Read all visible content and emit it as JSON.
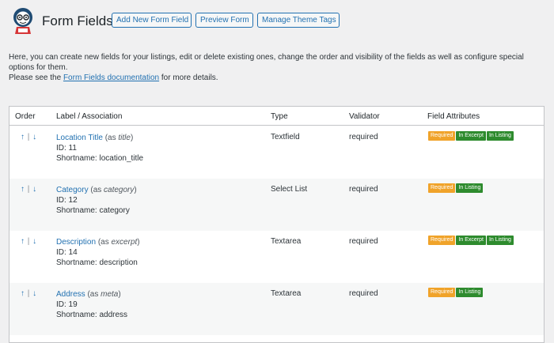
{
  "header": {
    "title": "Form Fields",
    "buttons": {
      "add": "Add New Form Field",
      "preview": "Preview Form",
      "tags": "Manage Theme Tags"
    }
  },
  "intro": {
    "line1": "Here, you can create new fields for your listings, edit or delete existing ones, change the order and visibility of the fields as well as configure special options for them.",
    "line2_prefix": "Please see the ",
    "link": "Form Fields documentation",
    "line2_suffix": " for more details."
  },
  "table": {
    "headers": {
      "order": "Order",
      "label": "Label / Association",
      "type": "Type",
      "validator": "Validator",
      "attributes": "Field Attributes"
    },
    "arrows": {
      "up": "↑",
      "sep": "|",
      "down": "↓"
    },
    "rows": [
      {
        "name": "Location Title",
        "assoc_pre": "(as ",
        "assoc": "title",
        "assoc_post": ")",
        "id": "ID: 11",
        "shortname": "Shortname: location_title",
        "type": "Textfield",
        "validator": "required",
        "badges": [
          "Required",
          "In Excerpt",
          "In Listing"
        ]
      },
      {
        "name": "Category",
        "assoc_pre": "(as ",
        "assoc": "category",
        "assoc_post": ")",
        "id": "ID: 12",
        "shortname": "Shortname: category",
        "type": "Select List",
        "validator": "required",
        "badges": [
          "Required",
          "In Listing"
        ]
      },
      {
        "name": "Description",
        "assoc_pre": "(as ",
        "assoc": "excerpt",
        "assoc_post": ")",
        "id": "ID: 14",
        "shortname": "Shortname: description",
        "type": "Textarea",
        "validator": "required",
        "badges": [
          "Required",
          "In Excerpt",
          "In Listing"
        ]
      },
      {
        "name": "Address",
        "assoc_pre": "(as ",
        "assoc": "meta",
        "assoc_post": ")",
        "id": "ID: 19",
        "shortname": "Shortname: address",
        "type": "Textarea",
        "validator": "required",
        "badges": [
          "Required",
          "In Listing"
        ]
      }
    ]
  },
  "colors": {
    "accent": "#2271b1",
    "required": "#f0a32a",
    "green": "#2e8b2e"
  },
  "icons": {
    "logo": "ninja-mascot-icon"
  }
}
